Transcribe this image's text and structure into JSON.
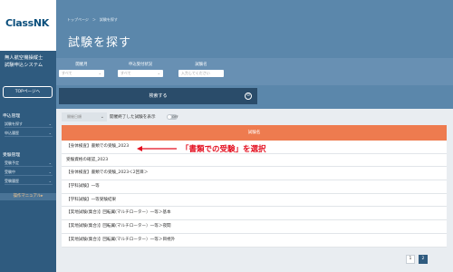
{
  "sidebar": {
    "logo": "ClassNK",
    "system_title_line1": "無人航空機操縦士",
    "system_title_line2": "試験申込システム",
    "top_button": "TOPページへ",
    "section1": {
      "heading": "申込管理",
      "items": [
        "試験を探す",
        "申込履歴"
      ]
    },
    "section2": {
      "heading": "受験管理",
      "items": [
        "受験予定",
        "受験中",
        "受験履歴"
      ]
    },
    "manual_button": "操作マニュアル▸"
  },
  "header": {
    "breadcrumb": "トップページ　＞　試験を探す",
    "title": "試験を探す"
  },
  "filters": [
    {
      "label": "開催月",
      "value": "すべて"
    },
    {
      "label": "申込受付状況",
      "value": "すべて"
    },
    {
      "label": "試験名",
      "value": "入力してください"
    }
  ],
  "search_button": "検索する",
  "search_icon_glyph": "⊙",
  "controls": {
    "sort_value": "開催日順",
    "toggle_label": "開催終了した試験を表示",
    "toggle_state": "OFF"
  },
  "table": {
    "header": "試験名",
    "rows": [
      "【身体検査】書類での受験_2023",
      "受験資格の確認_2023",
      "【身体検査】書類での受験_2023＜2回目＞",
      "【学科試験】一等",
      "【学科試験】一等受験結果",
      "【実地試験(集合)】回転翼(マルチローター）一等＞基本",
      "【実地試験(集合)】回転翼(マルチローター）一等＞夜間",
      "【実地試験(集合)】回転翼(マルチローター）一等＞目視外"
    ]
  },
  "annotation": "「書類での受験」を選択",
  "pagination": [
    "1",
    "2"
  ],
  "colors": {
    "sidebar": "#2f5b7f",
    "header": "#5b87ab",
    "table_header": "#ee7b4f",
    "annotation": "#e30e1e"
  }
}
